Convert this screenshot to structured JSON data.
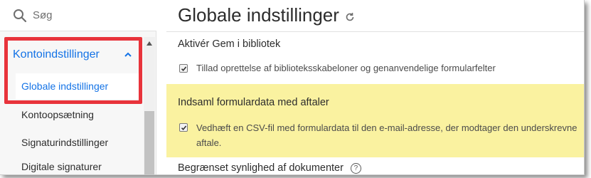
{
  "sidebar": {
    "search_placeholder": "Søg",
    "parent_label": "Kontoindstillinger",
    "items": [
      {
        "label": "Globale indstillinger",
        "active": true
      },
      {
        "label": "Kontoopsætning"
      },
      {
        "label": "Signaturindstillinger"
      },
      {
        "label": "Digitale signaturer"
      }
    ]
  },
  "main": {
    "title": "Globale indstillinger",
    "sections": [
      {
        "heading": "Aktivér Gem i bibliotek",
        "checkbox_label": "Tillad oprettelse af biblioteksskabeloner og genanvendelige formularfelter",
        "checked": true
      },
      {
        "heading": "Indsaml formulardata med aftaler",
        "checkbox_label": "Vedhæft en CSV-fil med formulardata til den e-mail-adresse, der modtager den underskrevne aftale.",
        "checked": true,
        "highlighted": true
      },
      {
        "heading": "Begrænset synlighed af dokumenter",
        "help": "?"
      }
    ]
  },
  "colors": {
    "accent": "#1473e6",
    "highlight": "#faf2a0",
    "annotation": "#e8333b"
  }
}
